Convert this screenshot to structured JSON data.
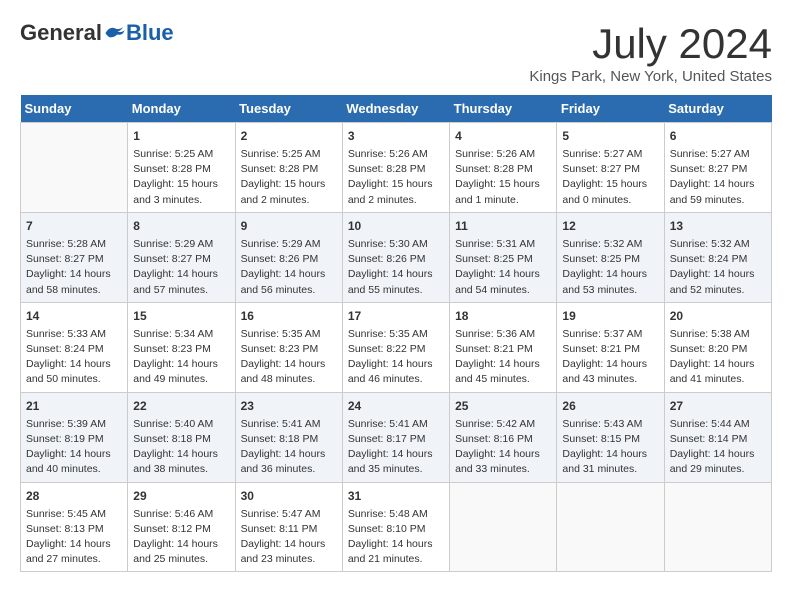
{
  "logo": {
    "general": "General",
    "blue": "Blue"
  },
  "title": "July 2024",
  "location": "Kings Park, New York, United States",
  "days_header": [
    "Sunday",
    "Monday",
    "Tuesday",
    "Wednesday",
    "Thursday",
    "Friday",
    "Saturday"
  ],
  "weeks": [
    [
      {
        "day": "",
        "content": ""
      },
      {
        "day": "1",
        "content": "Sunrise: 5:25 AM\nSunset: 8:28 PM\nDaylight: 15 hours\nand 3 minutes."
      },
      {
        "day": "2",
        "content": "Sunrise: 5:25 AM\nSunset: 8:28 PM\nDaylight: 15 hours\nand 2 minutes."
      },
      {
        "day": "3",
        "content": "Sunrise: 5:26 AM\nSunset: 8:28 PM\nDaylight: 15 hours\nand 2 minutes."
      },
      {
        "day": "4",
        "content": "Sunrise: 5:26 AM\nSunset: 8:28 PM\nDaylight: 15 hours\nand 1 minute."
      },
      {
        "day": "5",
        "content": "Sunrise: 5:27 AM\nSunset: 8:27 PM\nDaylight: 15 hours\nand 0 minutes."
      },
      {
        "day": "6",
        "content": "Sunrise: 5:27 AM\nSunset: 8:27 PM\nDaylight: 14 hours\nand 59 minutes."
      }
    ],
    [
      {
        "day": "7",
        "content": "Sunrise: 5:28 AM\nSunset: 8:27 PM\nDaylight: 14 hours\nand 58 minutes."
      },
      {
        "day": "8",
        "content": "Sunrise: 5:29 AM\nSunset: 8:27 PM\nDaylight: 14 hours\nand 57 minutes."
      },
      {
        "day": "9",
        "content": "Sunrise: 5:29 AM\nSunset: 8:26 PM\nDaylight: 14 hours\nand 56 minutes."
      },
      {
        "day": "10",
        "content": "Sunrise: 5:30 AM\nSunset: 8:26 PM\nDaylight: 14 hours\nand 55 minutes."
      },
      {
        "day": "11",
        "content": "Sunrise: 5:31 AM\nSunset: 8:25 PM\nDaylight: 14 hours\nand 54 minutes."
      },
      {
        "day": "12",
        "content": "Sunrise: 5:32 AM\nSunset: 8:25 PM\nDaylight: 14 hours\nand 53 minutes."
      },
      {
        "day": "13",
        "content": "Sunrise: 5:32 AM\nSunset: 8:24 PM\nDaylight: 14 hours\nand 52 minutes."
      }
    ],
    [
      {
        "day": "14",
        "content": "Sunrise: 5:33 AM\nSunset: 8:24 PM\nDaylight: 14 hours\nand 50 minutes."
      },
      {
        "day": "15",
        "content": "Sunrise: 5:34 AM\nSunset: 8:23 PM\nDaylight: 14 hours\nand 49 minutes."
      },
      {
        "day": "16",
        "content": "Sunrise: 5:35 AM\nSunset: 8:23 PM\nDaylight: 14 hours\nand 48 minutes."
      },
      {
        "day": "17",
        "content": "Sunrise: 5:35 AM\nSunset: 8:22 PM\nDaylight: 14 hours\nand 46 minutes."
      },
      {
        "day": "18",
        "content": "Sunrise: 5:36 AM\nSunset: 8:21 PM\nDaylight: 14 hours\nand 45 minutes."
      },
      {
        "day": "19",
        "content": "Sunrise: 5:37 AM\nSunset: 8:21 PM\nDaylight: 14 hours\nand 43 minutes."
      },
      {
        "day": "20",
        "content": "Sunrise: 5:38 AM\nSunset: 8:20 PM\nDaylight: 14 hours\nand 41 minutes."
      }
    ],
    [
      {
        "day": "21",
        "content": "Sunrise: 5:39 AM\nSunset: 8:19 PM\nDaylight: 14 hours\nand 40 minutes."
      },
      {
        "day": "22",
        "content": "Sunrise: 5:40 AM\nSunset: 8:18 PM\nDaylight: 14 hours\nand 38 minutes."
      },
      {
        "day": "23",
        "content": "Sunrise: 5:41 AM\nSunset: 8:18 PM\nDaylight: 14 hours\nand 36 minutes."
      },
      {
        "day": "24",
        "content": "Sunrise: 5:41 AM\nSunset: 8:17 PM\nDaylight: 14 hours\nand 35 minutes."
      },
      {
        "day": "25",
        "content": "Sunrise: 5:42 AM\nSunset: 8:16 PM\nDaylight: 14 hours\nand 33 minutes."
      },
      {
        "day": "26",
        "content": "Sunrise: 5:43 AM\nSunset: 8:15 PM\nDaylight: 14 hours\nand 31 minutes."
      },
      {
        "day": "27",
        "content": "Sunrise: 5:44 AM\nSunset: 8:14 PM\nDaylight: 14 hours\nand 29 minutes."
      }
    ],
    [
      {
        "day": "28",
        "content": "Sunrise: 5:45 AM\nSunset: 8:13 PM\nDaylight: 14 hours\nand 27 minutes."
      },
      {
        "day": "29",
        "content": "Sunrise: 5:46 AM\nSunset: 8:12 PM\nDaylight: 14 hours\nand 25 minutes."
      },
      {
        "day": "30",
        "content": "Sunrise: 5:47 AM\nSunset: 8:11 PM\nDaylight: 14 hours\nand 23 minutes."
      },
      {
        "day": "31",
        "content": "Sunrise: 5:48 AM\nSunset: 8:10 PM\nDaylight: 14 hours\nand 21 minutes."
      },
      {
        "day": "",
        "content": ""
      },
      {
        "day": "",
        "content": ""
      },
      {
        "day": "",
        "content": ""
      }
    ]
  ]
}
